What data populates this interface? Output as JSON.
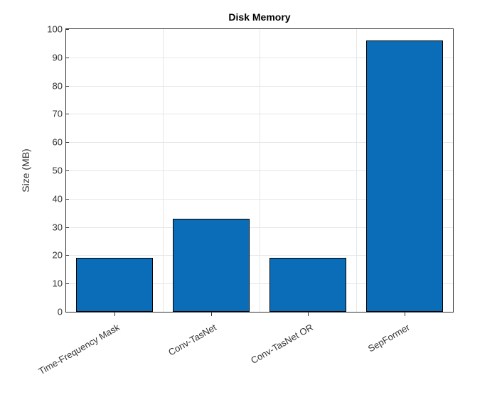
{
  "chart_data": {
    "type": "bar",
    "title": "Disk Memory",
    "ylabel": "Size (MB)",
    "xlabel": "",
    "categories": [
      "Time-Frequency Mask",
      "Conv-TasNet",
      "Conv-TasNet OR",
      "SepFormer"
    ],
    "values": [
      19,
      33,
      19,
      96
    ],
    "ylim": [
      0,
      100
    ],
    "yticks": [
      0,
      10,
      20,
      30,
      40,
      50,
      60,
      70,
      80,
      90,
      100
    ],
    "bar_color": "#0b6db7",
    "grid": true
  }
}
